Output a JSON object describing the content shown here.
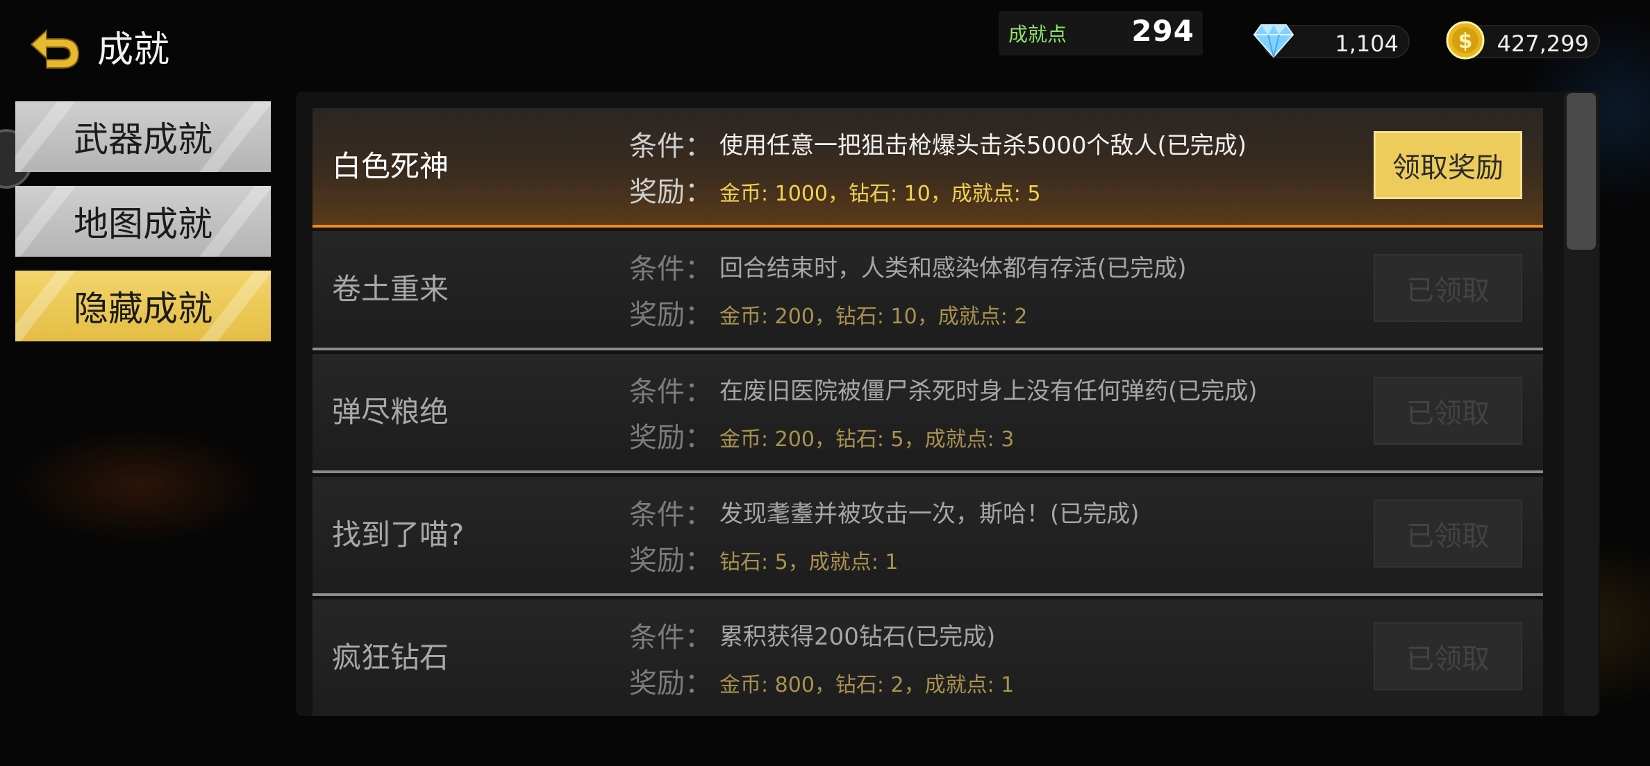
{
  "header": {
    "title": "成就",
    "back_icon": "back-arrow-icon"
  },
  "currency": {
    "points_label": "成就点",
    "points_value": "294",
    "diamonds": "1,104",
    "gold": "427,299",
    "diamond_icon": "diamond-icon",
    "gold_icon": "gold-coin-icon"
  },
  "tabs": [
    {
      "label": "武器成就",
      "active": false
    },
    {
      "label": "地图成就",
      "active": false
    },
    {
      "label": "隐藏成就",
      "active": true
    }
  ],
  "achievements": [
    {
      "name": "白色死神",
      "condition_label": "条件：",
      "condition": "使用任意一把狙击枪爆头击杀5000个敌人(已完成)",
      "reward_label": "奖励：",
      "reward": "金币: 1000，钻石: 10，成就点: 5",
      "action": "领取奖励",
      "state": "claimable"
    },
    {
      "name": "卷土重来",
      "condition_label": "条件：",
      "condition": "回合结束时，人类和感染体都有存活(已完成)",
      "reward_label": "奖励：",
      "reward": "金币: 200，钻石: 10，成就点: 2",
      "action": "已领取",
      "state": "claimed"
    },
    {
      "name": "弹尽粮绝",
      "condition_label": "条件：",
      "condition": "在废旧医院被僵尸杀死时身上没有任何弹药(已完成)",
      "reward_label": "奖励：",
      "reward": "金币: 200，钻石: 5，成就点: 3",
      "action": "已领取",
      "state": "claimed"
    },
    {
      "name": "找到了喵?",
      "condition_label": "条件：",
      "condition": "发现耄耋并被攻击一次，斯哈！(已完成)",
      "reward_label": "奖励：",
      "reward": " 钻石: 5，成就点: 1",
      "action": "已领取",
      "state": "claimed"
    },
    {
      "name": "疯狂钻石",
      "condition_label": "条件：",
      "condition": "累积获得200钻石(已完成)",
      "reward_label": "奖励：",
      "reward": "金币: 800，钻石: 2，成就点: 1",
      "action": "已领取",
      "state": "claimed"
    }
  ],
  "colors": {
    "accent_gold": "#edcc5c",
    "highlight_border": "#f08a1a",
    "points_label": "#8fe06a",
    "reward_text": "#f2d24e"
  }
}
